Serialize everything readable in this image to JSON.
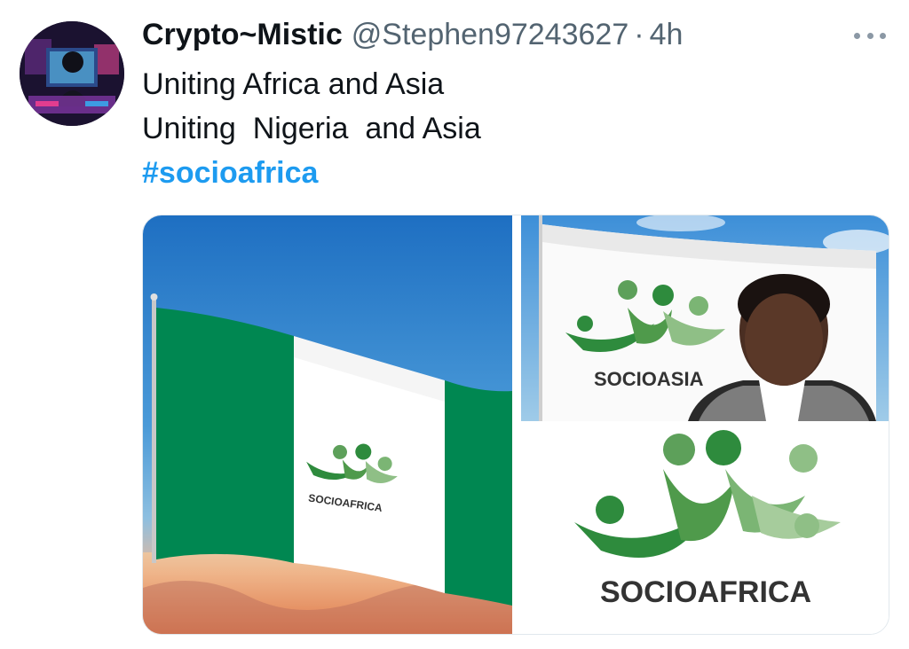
{
  "tweet": {
    "display_name": "Crypto~Mistic",
    "handle": "@Stephen97243627",
    "separator": "·",
    "time": "4h",
    "lines": [
      "Uniting Africa and Asia",
      "Uniting  Nigeria  and Asia"
    ],
    "hashtag": "#socioafrica"
  },
  "media": {
    "flag_logo_text": "SOCIOAFRICA",
    "asia_logo_text": "SOCIOASIA",
    "brand_logo_text": "SOCIOAFRICA"
  },
  "colors": {
    "nigeria_green": "#008751",
    "logo_green_dark": "#2e8b3d",
    "logo_green_light": "#6fae6a",
    "link_blue": "#1d9bf0"
  }
}
